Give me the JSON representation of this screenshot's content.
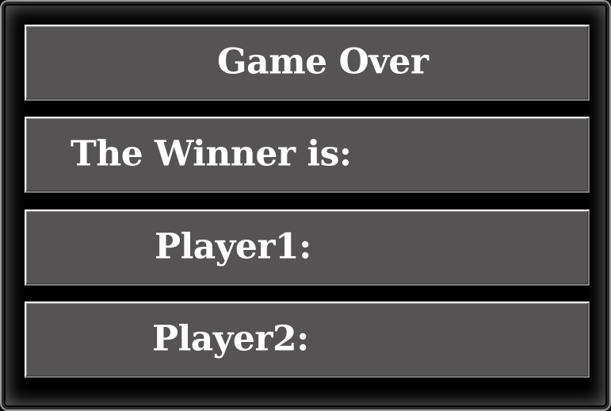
{
  "screen": {
    "title": "Game Over",
    "winner_label": "The Winner is:",
    "player1_label": "Player1:",
    "player2_label": "Player2:"
  },
  "colors": {
    "background": "#000000",
    "panel": "#555354",
    "text": "#ffffff",
    "panel_highlight": "#f2f2f2"
  }
}
